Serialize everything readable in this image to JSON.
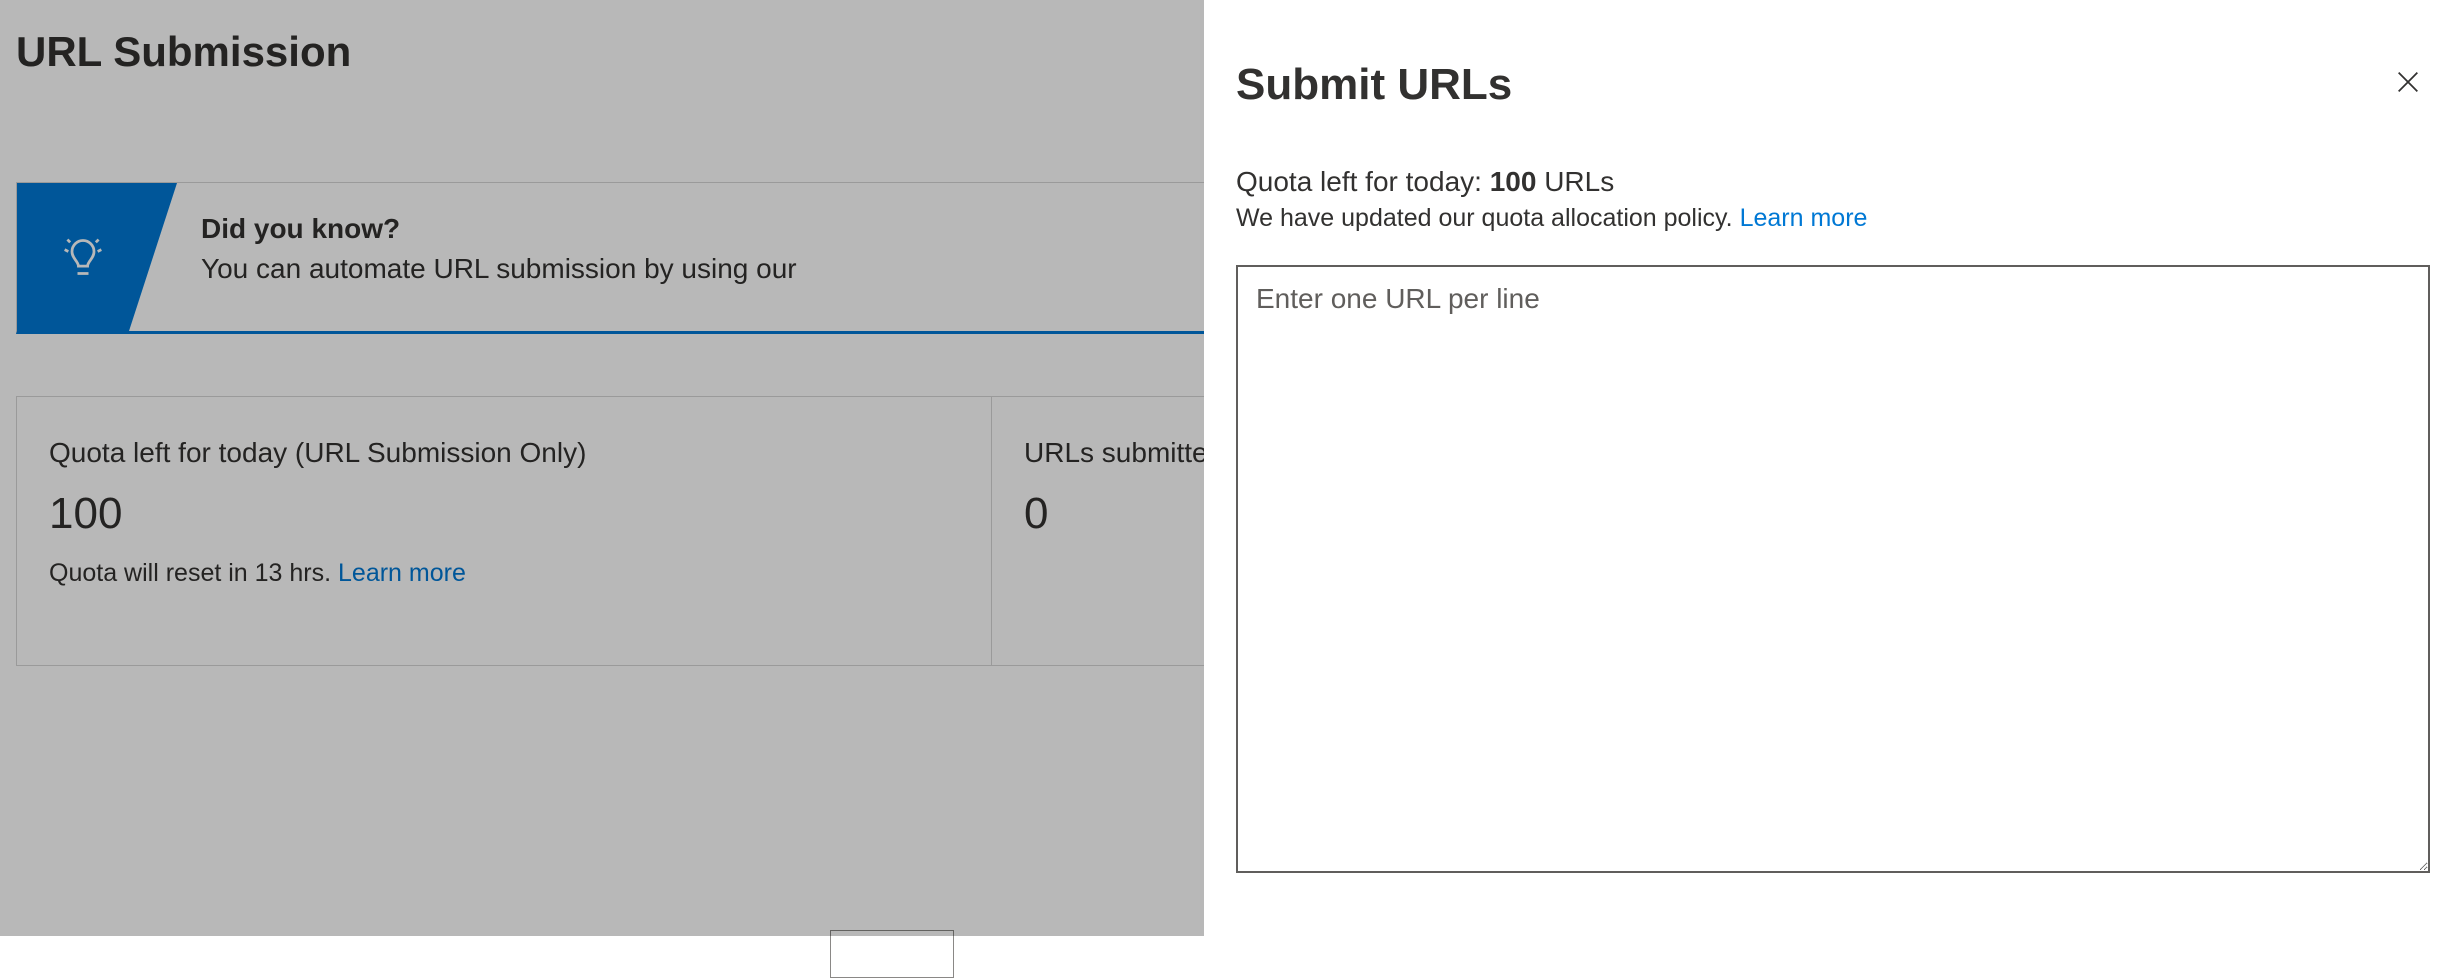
{
  "page": {
    "title": "URL Submission"
  },
  "banner": {
    "title": "Did you know?",
    "subtitle": "You can automate URL submission by using our"
  },
  "cards": {
    "quota": {
      "label": "Quota left for today (URL Submission Only)",
      "value": "100",
      "sub_prefix": "Quota will reset in 13 hrs. ",
      "learn_more": "Learn more"
    },
    "submitted": {
      "label": "URLs submitted today",
      "value": "0"
    }
  },
  "panel": {
    "title": "Submit URLs",
    "quota_prefix": "Quota left for today: ",
    "quota_value": "100",
    "quota_suffix": " URLs",
    "policy_text": "We have updated our quota allocation policy. ",
    "policy_link": "Learn more",
    "textarea_placeholder": "Enter one URL per line"
  }
}
